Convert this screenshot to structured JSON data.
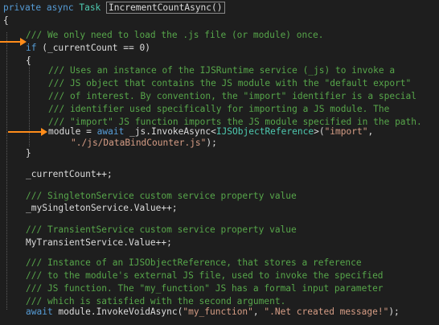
{
  "code": {
    "l01_kw1": "private",
    "l01_kw2": "async",
    "l01_type": "Task",
    "l01_method": "IncrementCountAsync()",
    "l02": "{",
    "l03_comment": "/// We only need to load the .js file (or module) once.",
    "l04_kw": "if",
    "l04_rest": " (_currentCount == 0)",
    "l05": "{",
    "l06": "/// Uses an instance of the IJSRuntime service (_js) to invoke a",
    "l07": "/// JS object that contains the JS module with the \"default export\"",
    "l08": "/// of interest. By convention, the \"import\" identifier is a special",
    "l09": "/// identifier used specifically for importing a JS module. The",
    "l10": "/// \"import\" JS function imports the JS module specified in the path.",
    "l11_a": "module = ",
    "l11_kw": "await",
    "l11_b": " _js.InvokeAsync<",
    "l11_type": "IJSObjectReference",
    "l11_c": ">(",
    "l11_str": "\"import\"",
    "l11_d": ",",
    "l12_str": "\"./js/DataBindCounter.js\"",
    "l12_end": ");",
    "l13": "}",
    "l14": "_currentCount++;",
    "l15": "/// SingletonService custom service property value",
    "l16": "_mySingletonService.Value++;",
    "l17": "/// TransientService custom service property value",
    "l18": "MyTransientService.Value++;",
    "l19": "/// Instance of an IJSObjectReference, that stores a reference",
    "l20": "/// to the module's external JS file, used to invoke the specified",
    "l21": "/// JS function. The \"my_function\" JS has a formal input parameter",
    "l22": "/// which is satisfied with the second argument.",
    "l23_kw": "await",
    "l23_a": " module.InvokeVoidAsync(",
    "l23_str1": "\"my_function\"",
    "l23_b": ", ",
    "l23_str2": "\".Net created message!\"",
    "l23_end": ");",
    "l24": "}"
  },
  "colors": {
    "background": "#1e1e1e",
    "keyword": "#569cd6",
    "type": "#4ec9b0",
    "comment": "#57a64a",
    "string": "#d69d85",
    "plain": "#dcdcdc",
    "arrow": "#ff8c1a"
  },
  "annotations": [
    "arrow-if-current-count",
    "arrow-module-assignment"
  ]
}
